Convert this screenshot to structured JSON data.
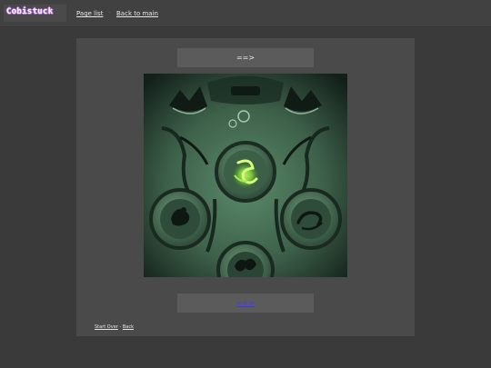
{
  "header": {
    "logo_text": "Cobistuck",
    "nav": {
      "page_list": "Page list",
      "separator": "·",
      "back_to_main": "Back to main"
    }
  },
  "comic": {
    "command_top": "==>",
    "command_bottom": "==>",
    "panel_image": "dark green carved stone relief with glowing zodiac emblems",
    "footer": {
      "start_over": "Start Over",
      "separator": "-",
      "back": "Back"
    }
  },
  "colors": {
    "page_bg": "#3a3a3a",
    "panel_bg": "#4a4a4a",
    "command_bg": "#5b5b5b",
    "link_blue": "#3a3aff",
    "glow_green": "#9cff3a",
    "logo_purple": "#b46fe0"
  }
}
